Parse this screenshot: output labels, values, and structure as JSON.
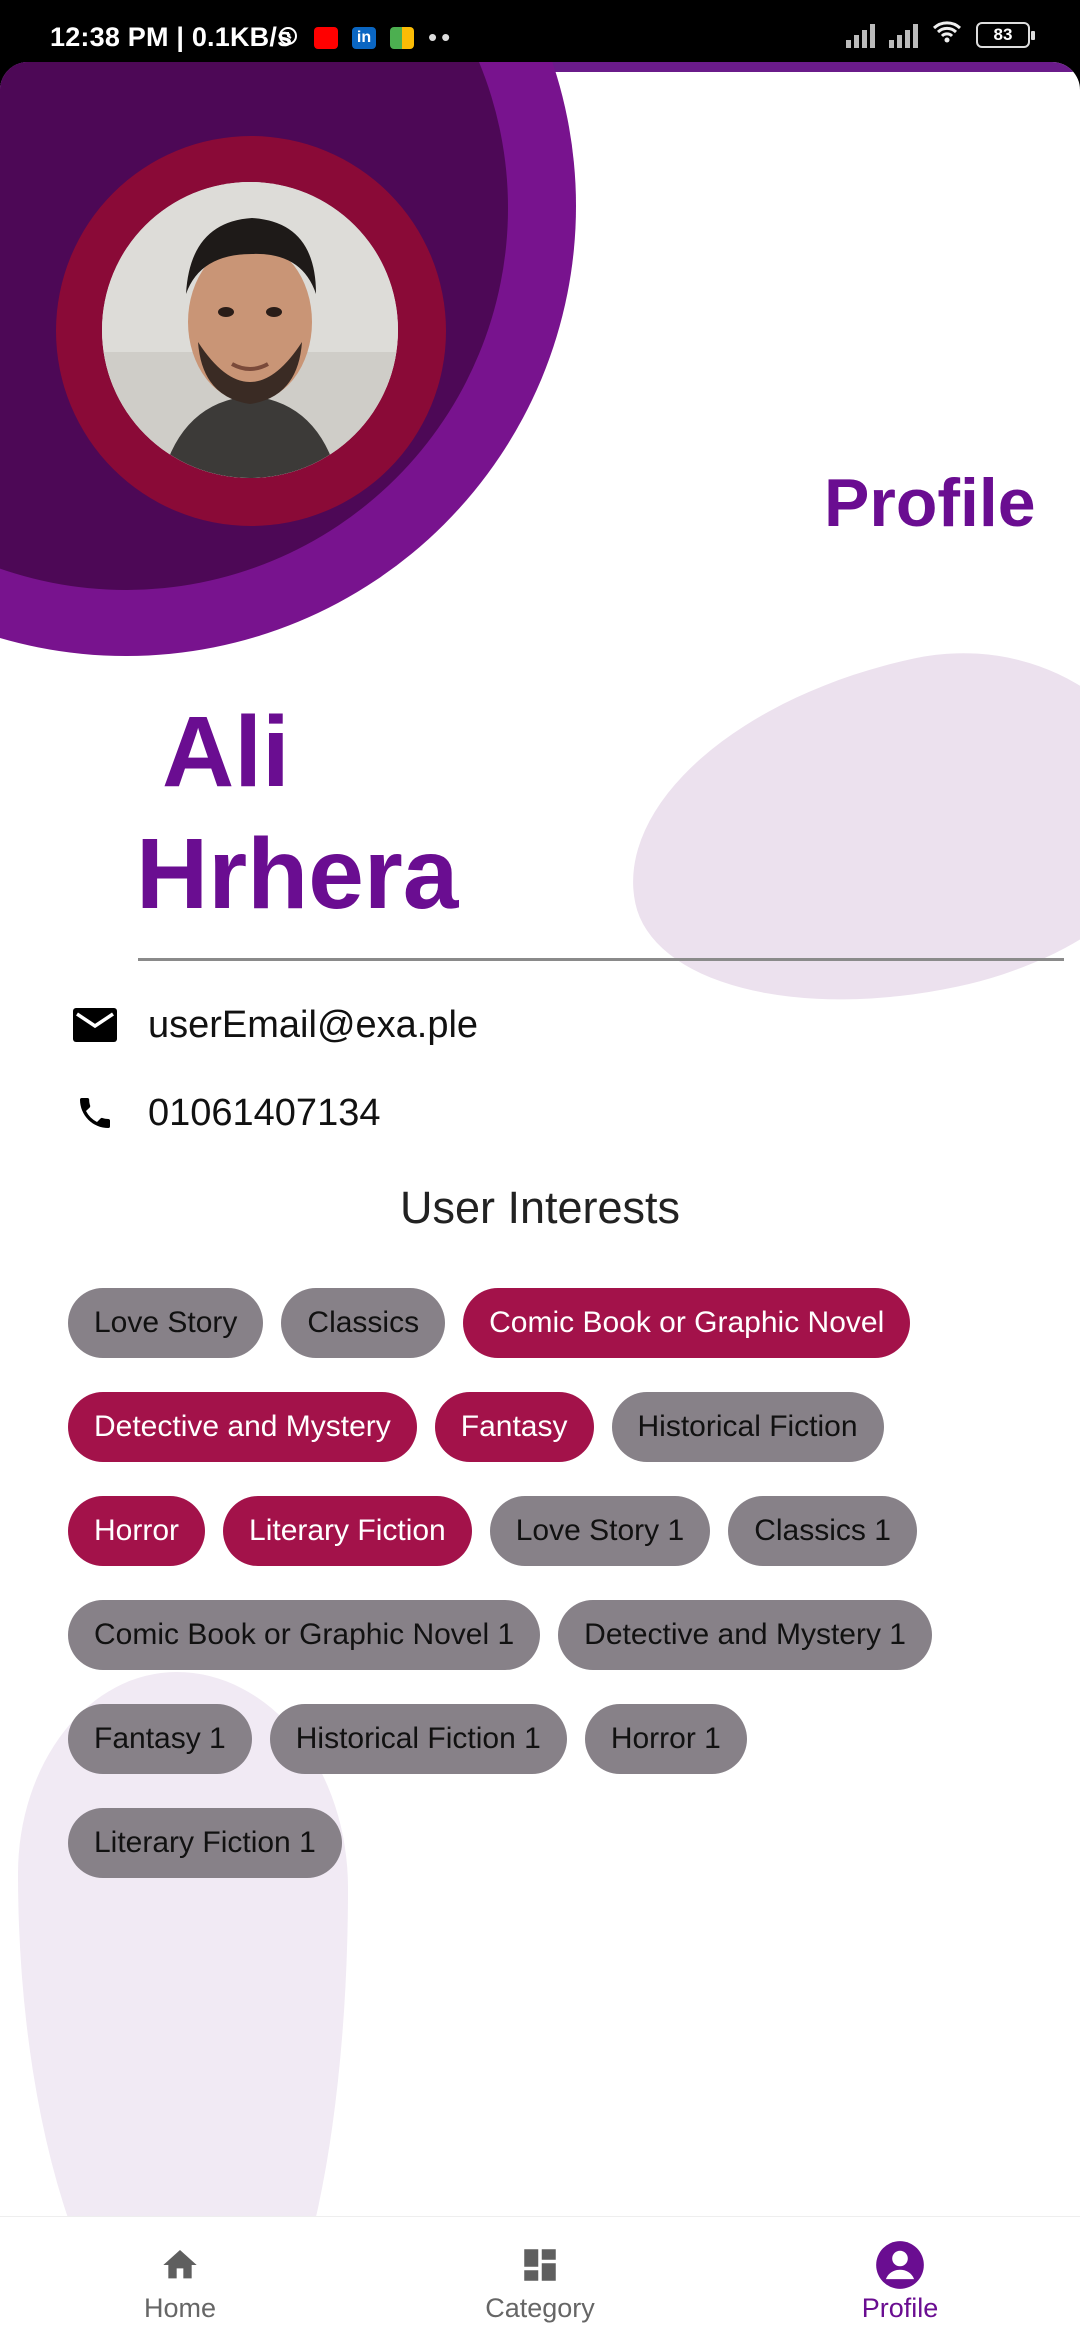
{
  "status_bar": {
    "time_speed": "12:38 PM | 0.1KB/s",
    "battery": "83",
    "icons": [
      "alarm-icon",
      "youtube-icon",
      "linkedin-icon",
      "app-icon",
      "more-dots-icon",
      "signal-icon",
      "signal-icon",
      "wifi-icon",
      "battery-icon"
    ]
  },
  "header": {
    "title": "Profile"
  },
  "user": {
    "first_name": "Ali",
    "last_name": "Hrhera",
    "email": "userEmail@exa.ple",
    "phone": "01061407134"
  },
  "interests": {
    "heading": "User Interests",
    "items": [
      {
        "label": "Love Story",
        "selected": false
      },
      {
        "label": "Classics",
        "selected": false
      },
      {
        "label": "Comic Book or Graphic Novel",
        "selected": true
      },
      {
        "label": "Detective and Mystery",
        "selected": true
      },
      {
        "label": "Fantasy",
        "selected": true
      },
      {
        "label": "Historical Fiction",
        "selected": false
      },
      {
        "label": "Horror",
        "selected": true
      },
      {
        "label": "Literary Fiction",
        "selected": true
      },
      {
        "label": "Love Story 1",
        "selected": false
      },
      {
        "label": "Classics 1",
        "selected": false
      },
      {
        "label": "Comic Book or Graphic Novel 1",
        "selected": false
      },
      {
        "label": "Detective and Mystery 1",
        "selected": false
      },
      {
        "label": "Fantasy 1",
        "selected": false
      },
      {
        "label": "Historical Fiction 1",
        "selected": false
      },
      {
        "label": "Horror 1",
        "selected": false
      },
      {
        "label": "Literary Fiction 1",
        "selected": false
      }
    ]
  },
  "bottom_nav": {
    "items": [
      {
        "label": "Home",
        "icon": "home-icon"
      },
      {
        "label": "Category",
        "icon": "category-icon"
      },
      {
        "label": "Profile",
        "icon": "profile-icon"
      }
    ],
    "active": "Profile"
  },
  "colors": {
    "accent": "#6a0d91",
    "selected_chip": "#a3124a",
    "chip": "#878188"
  }
}
